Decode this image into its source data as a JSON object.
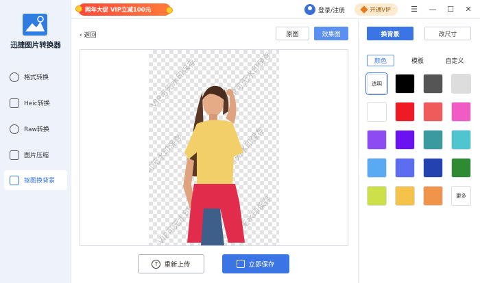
{
  "app": {
    "name": "迅捷图片转换器"
  },
  "promo": {
    "text": "网年大促 VIP立减100元"
  },
  "user": {
    "login": "登录/注册"
  },
  "vip": {
    "label": "开通VIP"
  },
  "window": {
    "menu": "☰",
    "minimize": "—",
    "maximize": "☐",
    "close": "✕"
  },
  "sidebar": {
    "items": [
      {
        "label": "格式转换"
      },
      {
        "label": "Heic转换"
      },
      {
        "label": "Raw转换"
      },
      {
        "label": "图片压缩"
      },
      {
        "label": "抠图换背景"
      }
    ]
  },
  "main": {
    "back": "返回",
    "tab_original": "原图",
    "tab_effect": "效果图",
    "watermark": "VIP可无水印保存",
    "reupload": "重新上传",
    "save": "立即保存"
  },
  "panel": {
    "btn_bg": "换背景",
    "btn_size": "改尺寸",
    "subtabs": [
      "颜色",
      "模板",
      "自定义"
    ],
    "swatches": [
      {
        "color": "#ffffff",
        "label": "透明"
      },
      {
        "color": "#000000",
        "label": ""
      },
      {
        "color": "#555555",
        "label": ""
      },
      {
        "color": "#dddddd",
        "label": ""
      },
      {
        "color": "#ffffff",
        "label": ""
      },
      {
        "color": "#ee1b24",
        "label": ""
      },
      {
        "color": "#ef5a5a",
        "label": ""
      },
      {
        "color": "#f05cc4",
        "label": ""
      },
      {
        "color": "#8c4cf2",
        "label": ""
      },
      {
        "color": "#6a12ef",
        "label": ""
      },
      {
        "color": "#3a9aa0",
        "label": ""
      },
      {
        "color": "#4ec5cf",
        "label": ""
      },
      {
        "color": "#5aaaf3",
        "label": ""
      },
      {
        "color": "#5c6df0",
        "label": ""
      },
      {
        "color": "#2442b0",
        "label": ""
      },
      {
        "color": "#2f8a34",
        "label": ""
      },
      {
        "color": "#cde049",
        "label": ""
      },
      {
        "color": "#f5c24a",
        "label": ""
      },
      {
        "color": "#ef944a",
        "label": ""
      },
      {
        "color": "#ffffff",
        "label": "更多"
      }
    ]
  },
  "colors": {
    "accent": "#3a74e5",
    "promo": "#ff4a3a"
  }
}
